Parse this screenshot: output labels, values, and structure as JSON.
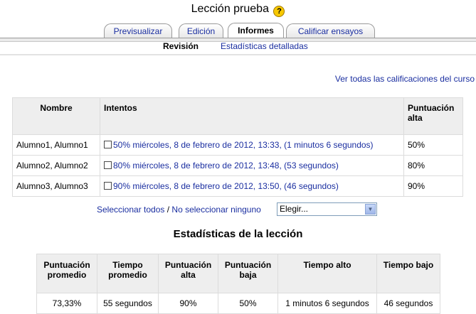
{
  "page": {
    "title": "Lección prueba",
    "help_icon_glyph": "?"
  },
  "tabs": [
    {
      "label": "Previsualizar",
      "selected": false
    },
    {
      "label": "Edición",
      "selected": false
    },
    {
      "label": "Informes",
      "selected": true
    },
    {
      "label": "Calificar ensayos",
      "selected": false
    }
  ],
  "subtabs": [
    {
      "label": "Revisión",
      "selected": true
    },
    {
      "label": "Estadísticas detalladas",
      "selected": false
    }
  ],
  "grades_link": "Ver todas las calificaciones del curso",
  "attempts_table": {
    "headers": [
      "Nombre",
      "Intentos",
      "Puntuación alta"
    ],
    "rows": [
      {
        "name": "Alumno1, Alumno1",
        "attempt": "50% miércoles, 8 de febrero de 2012, 13:33, (1 minutos 6 segundos)",
        "high": "50%"
      },
      {
        "name": "Alumno2, Alumno2",
        "attempt": "80% miércoles, 8 de febrero de 2012, 13:48, (53 segundos)",
        "high": "80%"
      },
      {
        "name": "Alumno3, Alumno3",
        "attempt": "90% miércoles, 8 de febrero de 2012, 13:50, (46 segundos)",
        "high": "90%"
      }
    ]
  },
  "selection": {
    "select_all": "Seleccionar todos",
    "separator": " / ",
    "select_none": "No seleccionar ninguno",
    "dropdown_value": "Elegir..."
  },
  "stats": {
    "title": "Estadísticas de la lección",
    "headers": [
      "Puntuación promedio",
      "Tiempo promedio",
      "Puntuación alta",
      "Puntuación baja",
      "Tiempo alto",
      "Tiempo bajo"
    ],
    "values": [
      "73,33%",
      "55 segundos",
      "90%",
      "50%",
      "1 minutos 6 segundos",
      "46 segundos"
    ]
  }
}
